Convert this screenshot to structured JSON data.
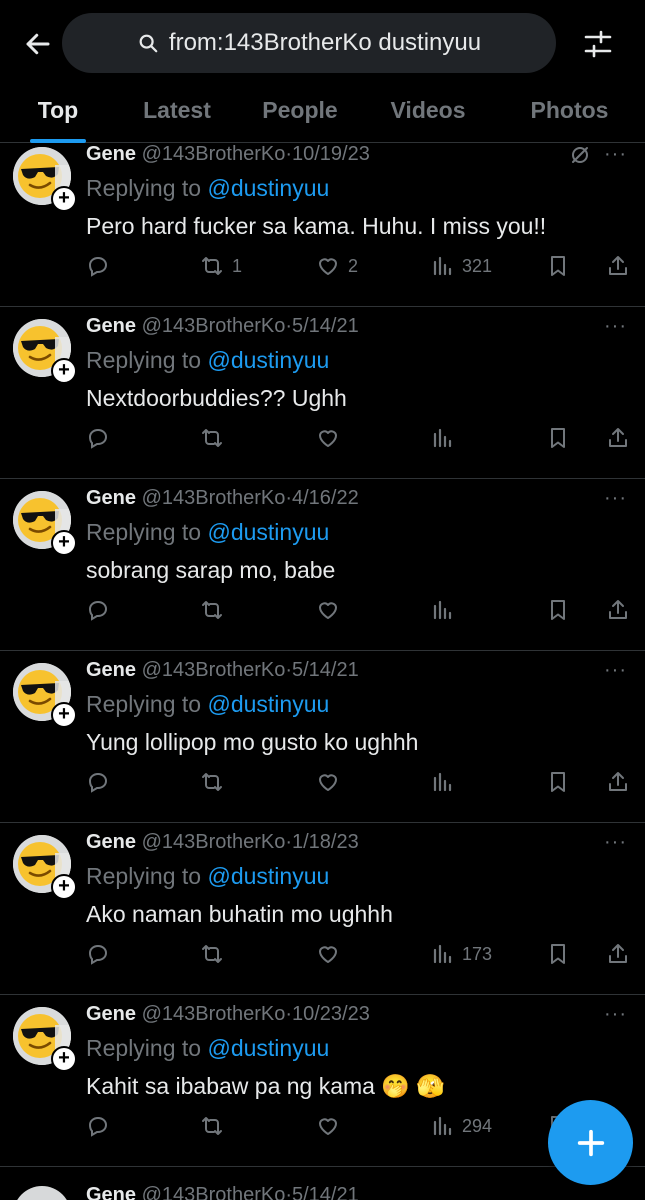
{
  "search": {
    "query": "from:143BrotherKo dustinyuu"
  },
  "tabs": [
    {
      "label": "Top",
      "active": true
    },
    {
      "label": "Latest",
      "active": false
    },
    {
      "label": "People",
      "active": false
    },
    {
      "label": "Videos",
      "active": false
    },
    {
      "label": "Photos",
      "active": false
    }
  ],
  "tweets": [
    {
      "name": "Gene",
      "handle": "@143BrotherKo",
      "date": "10/19/23",
      "replying_prefix": "Replying to ",
      "replying_to": "@dustinyuu",
      "text": "Pero hard fucker sa kama. Huhu. I miss you!!",
      "retweets": "1",
      "likes": "2",
      "views": "321"
    },
    {
      "name": "Gene",
      "handle": "@143BrotherKo",
      "date": "5/14/21",
      "replying_prefix": "Replying to ",
      "replying_to": "@dustinyuu",
      "text": "Nextdoorbuddies?? Ughh",
      "retweets": "",
      "likes": "",
      "views": ""
    },
    {
      "name": "Gene",
      "handle": "@143BrotherKo",
      "date": "4/16/22",
      "replying_prefix": "Replying to ",
      "replying_to": "@dustinyuu",
      "text": "sobrang sarap mo, babe",
      "retweets": "",
      "likes": "",
      "views": ""
    },
    {
      "name": "Gene",
      "handle": "@143BrotherKo",
      "date": "5/14/21",
      "replying_prefix": "Replying to ",
      "replying_to": "@dustinyuu",
      "text": "Yung lollipop mo gusto ko ughhh",
      "retweets": "",
      "likes": "",
      "views": ""
    },
    {
      "name": "Gene",
      "handle": "@143BrotherKo",
      "date": "1/18/23",
      "replying_prefix": "Replying to ",
      "replying_to": "@dustinyuu",
      "text": "Ako naman buhatin mo ughhh",
      "retweets": "",
      "likes": "",
      "views": "173"
    },
    {
      "name": "Gene",
      "handle": "@143BrotherKo",
      "date": "10/23/23",
      "replying_prefix": "Replying to ",
      "replying_to": "@dustinyuu",
      "text": "Kahit sa ibabaw pa ng kama 🤭 🫣",
      "retweets": "",
      "likes": "",
      "views": "294"
    }
  ],
  "partial_tweet": {
    "name": "Gene",
    "handle": "@143BrotherKo",
    "date": "5/14/21"
  },
  "meta_sep": "·",
  "more_dots": "···",
  "colors": {
    "accent": "#1d9bf0",
    "muted": "#71767b",
    "text": "#e7e9ea",
    "border": "#2f3336"
  },
  "icons": {
    "back": "arrow-left-icon",
    "search": "search-icon",
    "filter": "sliders-icon",
    "reply": "reply-icon",
    "retweet": "retweet-icon",
    "like": "heart-icon",
    "views": "views-icon",
    "bookmark": "bookmark-icon",
    "share": "share-icon",
    "compose": "plus-icon",
    "avatar": "sunglasses-emoji-icon",
    "grok": "grok-icon"
  }
}
